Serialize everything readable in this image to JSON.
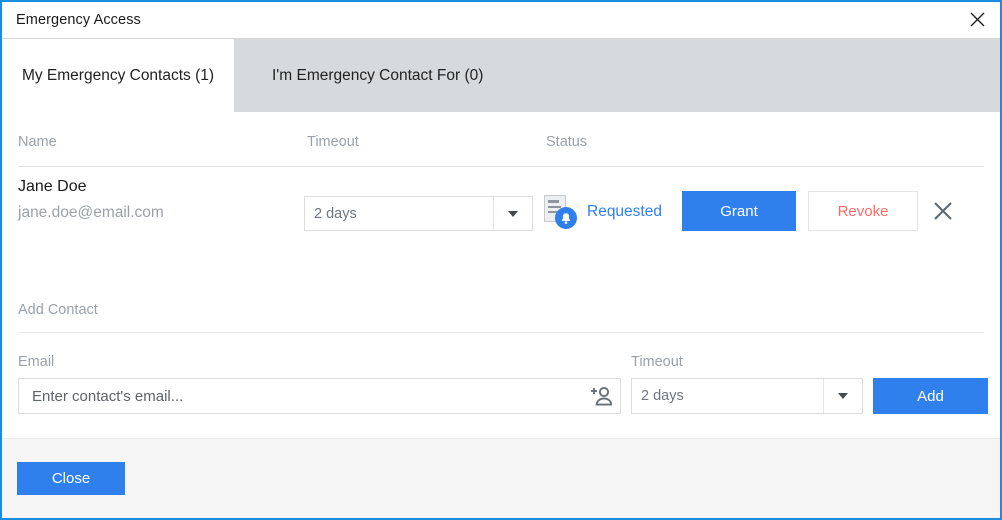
{
  "window": {
    "title": "Emergency Access",
    "close_icon": "close-icon",
    "border_color": "#1c8ce0"
  },
  "tabs": [
    {
      "label": "My Emergency Contacts (1)",
      "active": true
    },
    {
      "label": "I'm Emergency Contact For (0)",
      "active": false
    }
  ],
  "table": {
    "columns": [
      "Name",
      "Timeout",
      "Status"
    ],
    "rows": [
      {
        "name": "Jane Doe",
        "email": "jane.doe@email.com",
        "timeout": "2 days",
        "status": "Requested",
        "status_icon": "request-pending-icon",
        "status_color": "#2f80ed",
        "grant_label": "Grant",
        "revoke_label": "Revoke",
        "remove_icon": "close-icon"
      }
    ]
  },
  "add_contact": {
    "section_title": "Add Contact",
    "email_label": "Email",
    "email_value": "",
    "email_placeholder": "Enter contact's email...",
    "add_user_icon": "add-user-icon",
    "timeout_label": "Timeout",
    "timeout_value": "2 days",
    "add_label": "Add"
  },
  "footer": {
    "close_label": "Close"
  },
  "colors": {
    "accent": "#2f80ed",
    "danger": "#fc6a67",
    "muted": "#9aa1aa",
    "tab_inactive_bg": "#d7dadd"
  }
}
